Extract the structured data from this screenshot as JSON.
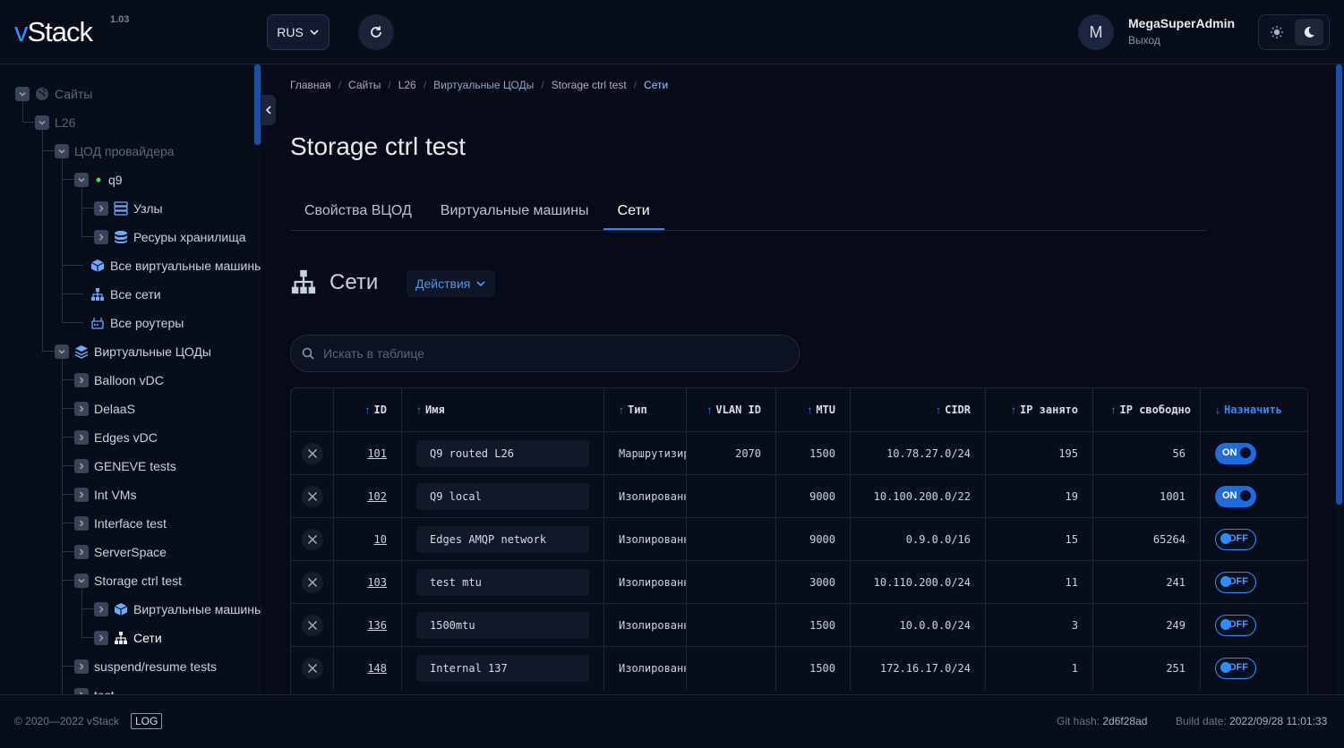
{
  "header": {
    "logo": "vStack",
    "version": "1.03",
    "language": "RUS",
    "user": {
      "initial": "M",
      "name": "MegaSuperAdmin",
      "logout": "Выход"
    }
  },
  "sidebar": {
    "tree": [
      {
        "label": "Сайты",
        "icon": "globe-icon",
        "dim": true
      },
      {
        "label": "L26",
        "dim": true
      },
      {
        "label": "ЦОД провайдера",
        "dim": true
      },
      {
        "label": "q9",
        "icon": "status-dot-icon"
      },
      {
        "label": "Узлы",
        "icon": "server-icon"
      },
      {
        "label": "Ресуры хранилища",
        "icon": "database-icon"
      },
      {
        "label": "Все виртуальные машины",
        "icon": "cube-icon"
      },
      {
        "label": "Все сети",
        "icon": "network-icon"
      },
      {
        "label": "Все роутеры",
        "icon": "router-icon"
      },
      {
        "label": "Виртуальные ЦОДы",
        "icon": "layers-icon"
      },
      {
        "label": "Balloon vDC"
      },
      {
        "label": "DelaaS"
      },
      {
        "label": "Edges vDC"
      },
      {
        "label": "GENEVE tests"
      },
      {
        "label": "Int VMs"
      },
      {
        "label": "Interface test"
      },
      {
        "label": "ServerSpace"
      },
      {
        "label": "Storage ctrl test"
      },
      {
        "label": "Виртуальные машины",
        "icon": "cube-icon"
      },
      {
        "label": "Сети",
        "icon": "network-icon"
      },
      {
        "label": "suspend/resume tests"
      },
      {
        "label": "test"
      }
    ]
  },
  "breadcrumbs": [
    "Главная",
    "Сайты",
    "L26",
    "Виртуальные ЦОДы",
    "Storage ctrl test",
    "Сети"
  ],
  "page_title": "Storage ctrl test",
  "tabs": [
    "Свойства ВЦОД",
    "Виртуальные машины",
    "Сети"
  ],
  "section": {
    "title": "Сети",
    "actions": "Действия"
  },
  "search": {
    "placeholder": "Искать в таблице"
  },
  "table": {
    "columns": [
      "ID",
      "Имя",
      "Тип",
      "VLAN ID",
      "MTU",
      "CIDR",
      "IP занято",
      "IP свободно",
      "Назначить"
    ],
    "rows": [
      {
        "id": "101",
        "name": "Q9 routed L26",
        "type": "Маршрутизируемая",
        "vlan": "2070",
        "mtu": "1500",
        "cidr": "10.78.27.0/24",
        "used": "195",
        "free": "56",
        "assign": "ON"
      },
      {
        "id": "102",
        "name": "Q9 local",
        "type": "Изолированная",
        "vlan": "",
        "mtu": "9000",
        "cidr": "10.100.200.0/22",
        "used": "19",
        "free": "1001",
        "assign": "ON"
      },
      {
        "id": "10",
        "name": "Edges AMQP network",
        "type": "Изолированная",
        "vlan": "",
        "mtu": "9000",
        "cidr": "0.9.0.0/16",
        "used": "15",
        "free": "65264",
        "assign": "OFF"
      },
      {
        "id": "103",
        "name": "test mtu",
        "type": "Изолированная",
        "vlan": "",
        "mtu": "3000",
        "cidr": "10.110.200.0/24",
        "used": "11",
        "free": "241",
        "assign": "OFF"
      },
      {
        "id": "136",
        "name": "1500mtu",
        "type": "Изолированная",
        "vlan": "",
        "mtu": "1500",
        "cidr": "10.0.0.0/24",
        "used": "3",
        "free": "249",
        "assign": "OFF"
      },
      {
        "id": "148",
        "name": "Internal 137",
        "type": "Изолированная",
        "vlan": "",
        "mtu": "1500",
        "cidr": "172.16.17.0/24",
        "used": "1",
        "free": "251",
        "assign": "OFF"
      }
    ]
  },
  "footer": {
    "copyright": "© 2020—2022 vStack",
    "log": "LOG",
    "git_hash_label": "Git hash:",
    "git_hash": "2d6f28ad",
    "build_date_label": "Build date:",
    "build_date": "2022/09/28 11:01:33"
  },
  "colors": {
    "accent": "#2f8cff",
    "background": "#060b17",
    "status_online": "#3ddc5a"
  }
}
